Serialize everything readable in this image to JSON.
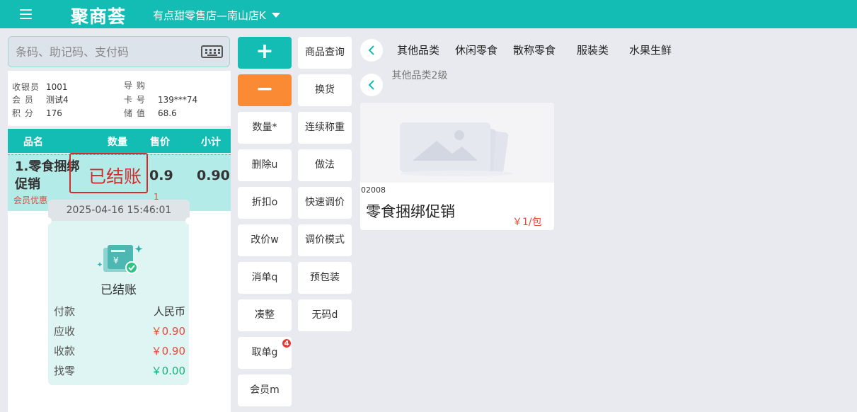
{
  "header": {
    "logo": "聚商荟",
    "store_name": "有点甜零售店—南山店K"
  },
  "search": {
    "placeholder": "条码、助记码、支付码"
  },
  "info": {
    "cashier_label": "收银员",
    "cashier_value": "1001",
    "guide_label": "导 购",
    "guide_value": "",
    "member_label": "会 员",
    "member_value": "测试4",
    "card_label": "卡 号",
    "card_value": "139***74",
    "points_label": "积 分",
    "points_value": "176",
    "balance_label": "储 值",
    "balance_value": "68.6"
  },
  "grid": {
    "headers": {
      "name": "品名",
      "qty": "数量",
      "price": "售价",
      "subtotal": "小计"
    },
    "item": {
      "name": "1.零食捆绑促销",
      "promo": "会员优惠",
      "price": "0.9",
      "subtotal": "0.90",
      "partial_hidden": "1"
    }
  },
  "stamp": {
    "text": "已结账"
  },
  "receipt": {
    "time": "2025-04-16 15:46:01",
    "title": "已结账",
    "lines": [
      {
        "label": "付款",
        "value": "人民币",
        "color": "#333333"
      },
      {
        "label": "应收",
        "value": "￥0.90",
        "color": "#e64a3b"
      },
      {
        "label": "收款",
        "value": "￥0.90",
        "color": "#e64a3b"
      },
      {
        "label": "找零",
        "value": "￥0.00",
        "color": "#16b37b"
      }
    ]
  },
  "buttons_left": {
    "plus": "+",
    "minus": "−",
    "qty": "数量*",
    "delete": "删除u",
    "discount": "折扣o",
    "change_price": "改价w",
    "cancel_order": "消单q",
    "round": "凑整",
    "take_order": "取单g",
    "member": "会员m",
    "take_order_badge": "4"
  },
  "buttons_right": {
    "product_query": "商品查询",
    "exchange": "换货",
    "continuous_weigh": "连续称重",
    "recipe": "做法",
    "quick_price": "快速调价",
    "price_mode": "调价模式",
    "prepack": "预包装",
    "no_code": "无码d"
  },
  "categories": [
    "其他品类",
    "休闲零食",
    "散称零食",
    "服装类",
    "水果生鲜"
  ],
  "subcategory": "其他品类2级",
  "product": {
    "code": "02008",
    "name": "零食捆绑促销",
    "price": "￥1/包"
  },
  "colors": {
    "brand": "#14bdb4",
    "accent_orange": "#fa8a34",
    "red": "#e64a3b",
    "green": "#16b37b"
  }
}
